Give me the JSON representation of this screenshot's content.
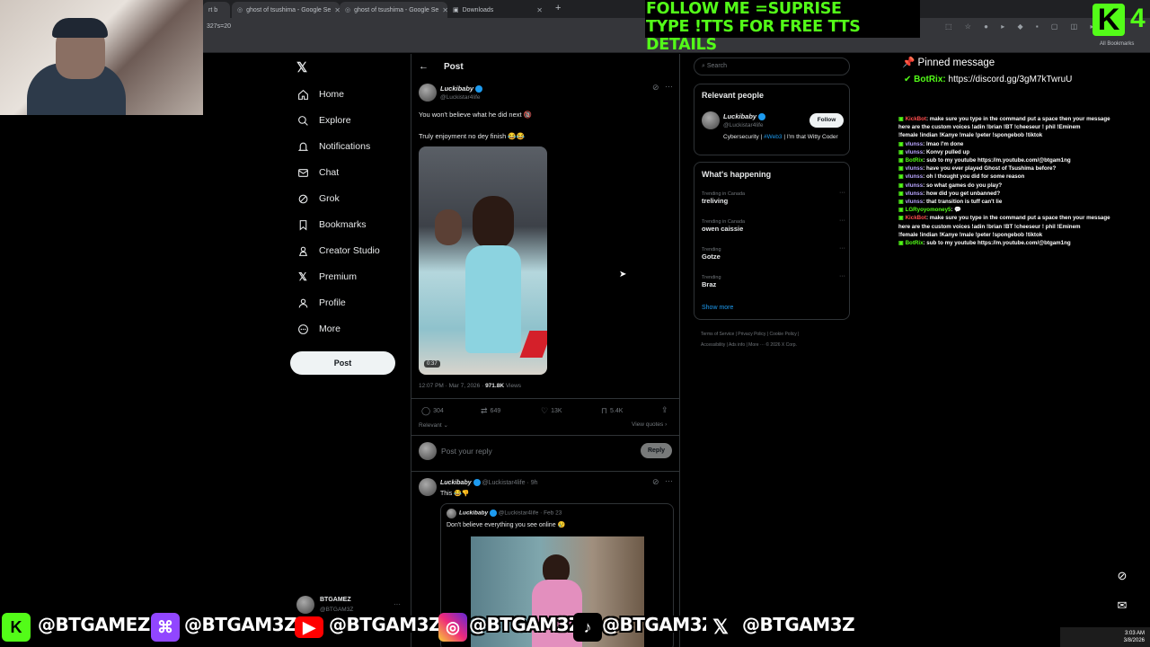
{
  "browser": {
    "tabs": [
      {
        "label": "rt b"
      },
      {
        "label": "ghost of tsushima - Google Se"
      },
      {
        "label": "ghost of tsushima - Google Se"
      },
      {
        "label": "Downloads"
      }
    ],
    "new_tab": "+",
    "address_fragment": "327s=20",
    "all_bookmarks": "All Bookmarks"
  },
  "overlay": {
    "line1": "FOLLOW ME =SUPRISE",
    "line2": "TYPE !TTS FOR FREE TTS DETAILS",
    "kick_letter": "K",
    "kick_count": "4",
    "pinned_title": "Pinned message",
    "pinned_user": "BotRix:",
    "pinned_link": "https://discord.gg/3gM7kTwruU"
  },
  "nav": {
    "items": [
      {
        "label": "Home",
        "icon": "home-icon"
      },
      {
        "label": "Explore",
        "icon": "search-icon"
      },
      {
        "label": "Notifications",
        "icon": "bell-icon"
      },
      {
        "label": "Chat",
        "icon": "mail-icon"
      },
      {
        "label": "Grok",
        "icon": "grok-icon"
      },
      {
        "label": "Bookmarks",
        "icon": "bookmark-icon"
      },
      {
        "label": "Creator Studio",
        "icon": "creator-icon"
      },
      {
        "label": "Premium",
        "icon": "x-icon"
      },
      {
        "label": "Profile",
        "icon": "person-icon"
      },
      {
        "label": "More",
        "icon": "more-icon"
      }
    ],
    "post_button": "Post",
    "account_name": "BTGAMEZ",
    "account_handle": "@BTGAM3Z",
    "account_more": "···"
  },
  "post": {
    "header": "Post",
    "author": "Luckibaby",
    "handle": "@Luckistar4life",
    "text1": "You won't believe what he did next 🔞",
    "text2": "Truly enjoyment no dey finish 😂😂",
    "duration": "0:37",
    "time": "12:07 PM · Mar 7, 2026 · ",
    "views_count": "971.8K",
    "views_label": " Views",
    "replies": "304",
    "reposts": "649",
    "likes": "13K",
    "bookmarks": "5.4K",
    "relevant": "Relevant",
    "view_quotes": "View quotes",
    "reply_placeholder": "Post your reply",
    "reply_button": "Reply"
  },
  "reply_tweet": {
    "author": "Luckibaby",
    "handle": "@Luckistar4life · 9h",
    "text": "This 😂👎",
    "quoted_author": "Luckibaby",
    "quoted_handle": "@Luckistar4life · Feb 23",
    "quoted_text": "Don't believe everything you see online 😢"
  },
  "sidebar": {
    "search_placeholder": "Search",
    "relevant_title": "Relevant people",
    "person_name": "Luckibaby",
    "person_handle": "@Luckistar4life",
    "person_bio_a": "Cybersecurity | ",
    "person_bio_tag": "#Web3",
    "person_bio_b": " | I'm that Witty Coder",
    "follow_label": "Follow",
    "happening_title": "What's happening",
    "trends": [
      {
        "context": "Trending in Canada",
        "name": "treliving"
      },
      {
        "context": "Trending in Canada",
        "name": "owen caissie"
      },
      {
        "context": "Trending",
        "name": "Gotze"
      },
      {
        "context": "Trending",
        "name": "Braz"
      }
    ],
    "show_more": "Show more",
    "footer1": "Terms of Service  |  Privacy Policy  |  Cookie Policy  |",
    "footer2": "Accessibility  |  Ads info  |  More ···  © 2026 X Corp."
  },
  "chat": [
    {
      "user": "KickBot",
      "cls": "kick",
      "msg": ": make sure you type in the command put a space then your message"
    },
    {
      "user": "",
      "cls": "",
      "msg": "here are the custom voices !adin  !brian  !BT  !cheeseur  ! phil  !Eminem"
    },
    {
      "user": "",
      "cls": "",
      "msg": "!female  !indian  !Kanye  !male  !peter  !spongebob  !tiktok"
    },
    {
      "user": "vlunss",
      "cls": "un",
      "msg": ": lmao I'm done"
    },
    {
      "user": "vlunss",
      "cls": "un",
      "msg": ": Konvy pulled up"
    },
    {
      "user": "BotRix",
      "cls": "bot",
      "msg": ": sub to my youtube https://m.youtube.com/@btgam1ng"
    },
    {
      "user": "vlunss",
      "cls": "un",
      "msg": ": have you ever played Ghost of Tsushima before?"
    },
    {
      "user": "vlunss",
      "cls": "un",
      "msg": ": oh I thought you did for some reason"
    },
    {
      "user": "vlunss",
      "cls": "un",
      "msg": ": so what games do you play?"
    },
    {
      "user": "vlunss",
      "cls": "un",
      "msg": ": how did you get unbanned?"
    },
    {
      "user": "vlunss",
      "cls": "un",
      "msg": ": that transition is tuff can't lie"
    },
    {
      "user": "LGRyoyomoney5",
      "cls": "bot",
      "msg": ": 💬"
    },
    {
      "user": "KickBot",
      "cls": "kick",
      "msg": ": make sure you type in the command put a space then your message"
    },
    {
      "user": "",
      "cls": "",
      "msg": "here are the custom voices !adin  !brian  !BT  !cheeseur  ! phil  !Eminem"
    },
    {
      "user": "",
      "cls": "",
      "msg": "!female  !indian  !Kanye  !male  !peter  !spongebob  !tiktok"
    },
    {
      "user": "BotRix",
      "cls": "bot",
      "msg": ": sub to my youtube https://m.youtube.com/@btgam1ng"
    }
  ],
  "socials": {
    "kick": "@BTGAMEZ",
    "twitch": "@BTGAM3Z",
    "youtube": "@BTGAM3Z",
    "instagram": "@BTGAM3Z",
    "tiktok": "@BTGAM3Z",
    "x": "@BTGAM3Z"
  },
  "taskbar": {
    "time": "3:03 AM",
    "date": "3/8/2026"
  },
  "colors": {
    "kick_green": "#53fc18",
    "x_blue": "#1d9bf0",
    "background": "#000000"
  }
}
